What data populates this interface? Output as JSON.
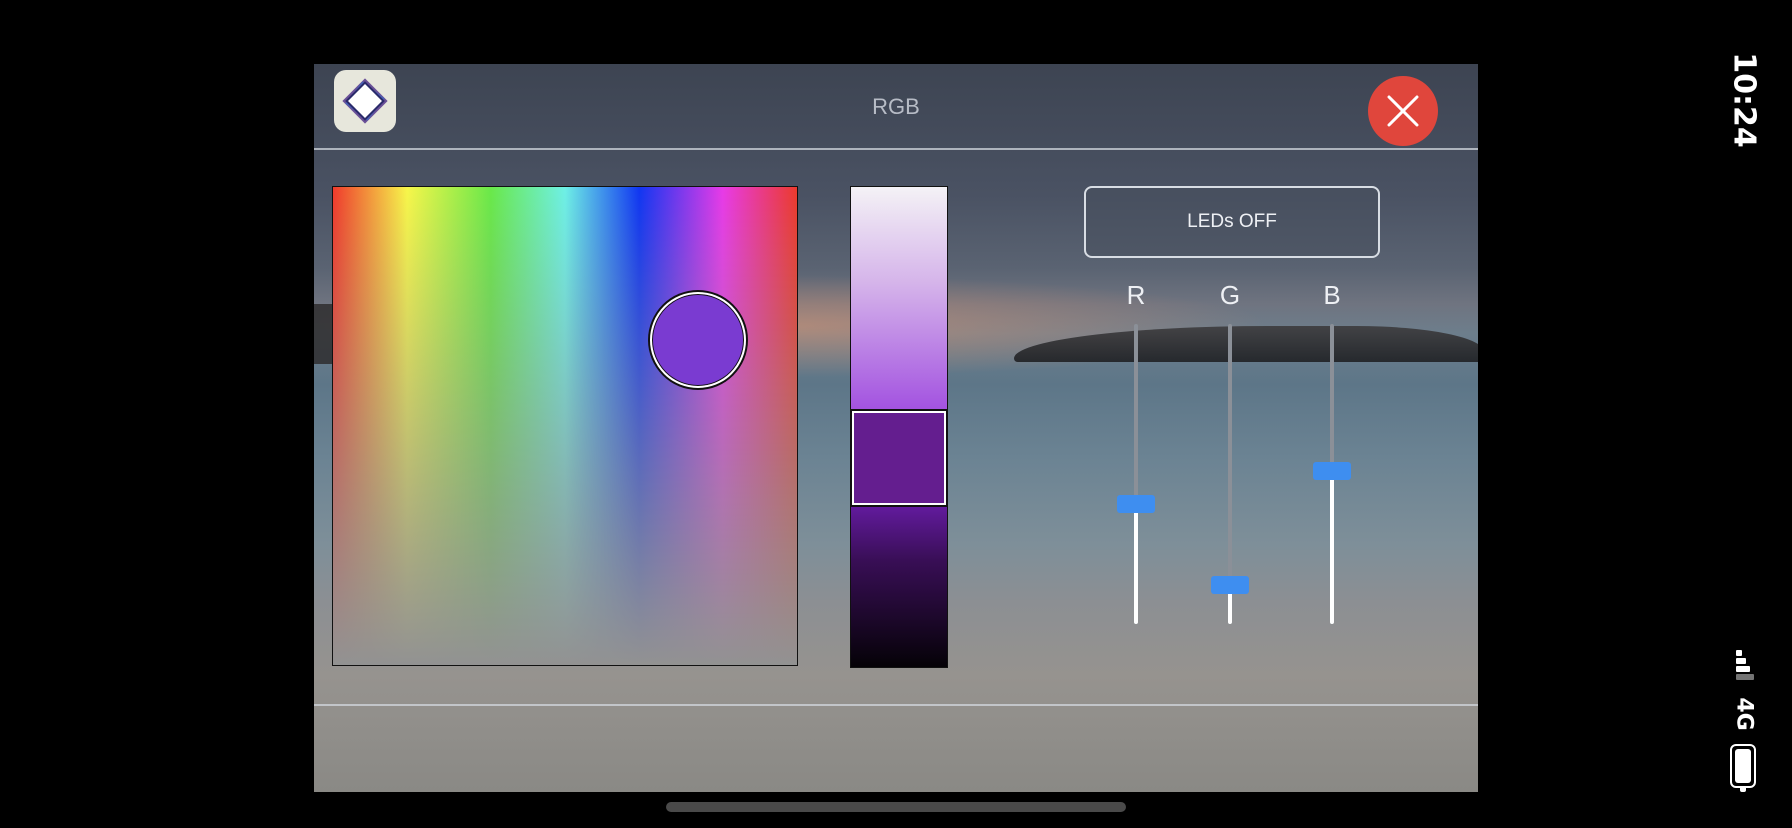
{
  "status_bar": {
    "time": "10:24",
    "network": "4G"
  },
  "header": {
    "title": "RGB",
    "logo_icon": "app-diamond-logo",
    "close_icon": "close-x-icon"
  },
  "color_picker": {
    "selected_color": "#7a3bd1",
    "hue_colors": [
      "#f03a2c",
      "#f7f64a",
      "#69e949",
      "#6ef0e6",
      "#1036f2",
      "#e83ae8",
      "#ec3a2c"
    ]
  },
  "brightness": {
    "selected_color": "#641e8f",
    "level": 0.35
  },
  "leds_button": {
    "label": "LEDs OFF"
  },
  "rgb_sliders": [
    {
      "label": "R",
      "value": 0.4
    },
    {
      "label": "G",
      "value": 0.13
    },
    {
      "label": "B",
      "value": 0.51
    }
  ],
  "colors": {
    "close_button": "#e0463c",
    "slider_thumb": "#3e8ef0"
  }
}
